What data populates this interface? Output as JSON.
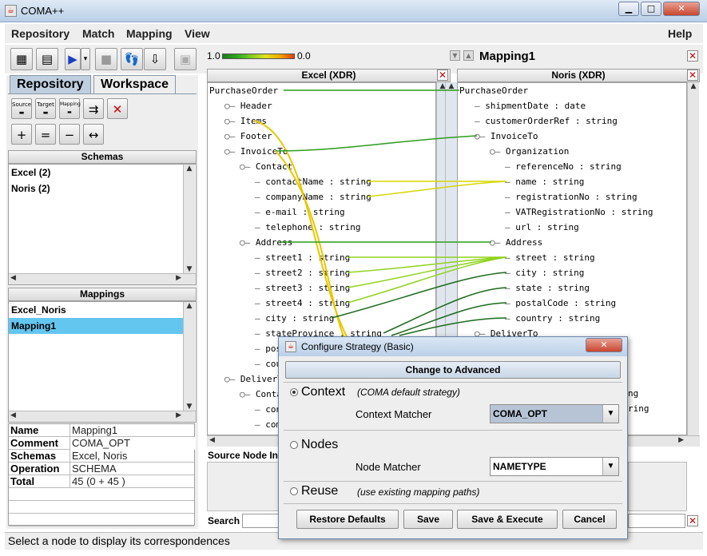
{
  "window": {
    "title": "COMA++"
  },
  "menu": {
    "items": [
      "Repository",
      "Match",
      "Mapping",
      "View"
    ],
    "help": "Help"
  },
  "legend": {
    "max": "1.0",
    "min": "0.0"
  },
  "tabs": {
    "repository": "Repository",
    "workspace": "Workspace"
  },
  "workspace_icons": {
    "source": "Source",
    "target": "Target",
    "mapping": "Mapping"
  },
  "schemas": {
    "header": "Schemas",
    "items": [
      "Excel (2)",
      "Noris (2)"
    ]
  },
  "mappings": {
    "header": "Mappings",
    "items": [
      "Excel_Noris",
      "Mapping1"
    ],
    "selected": "Mapping1"
  },
  "properties": [
    {
      "key": "Name",
      "value": "Mapping1"
    },
    {
      "key": "Comment",
      "value": "COMA_OPT"
    },
    {
      "key": "Schemas",
      "value": "Excel, Noris"
    },
    {
      "key": "Operation",
      "value": "SCHEMA"
    },
    {
      "key": "Total",
      "value": "45 (0 + 45 )"
    }
  ],
  "mapping_title": "Mapping1",
  "source_tree": {
    "header": "Excel (XDR)",
    "nodes": [
      {
        "label": "PurchaseOrder",
        "depth": 0
      },
      {
        "label": "Header",
        "depth": 1
      },
      {
        "label": "Items",
        "depth": 1
      },
      {
        "label": "Footer",
        "depth": 1
      },
      {
        "label": "InvoiceTo",
        "depth": 1
      },
      {
        "label": "Contact",
        "depth": 2
      },
      {
        "label": "contactName : string",
        "depth": 3
      },
      {
        "label": "companyName : string",
        "depth": 3
      },
      {
        "label": "e-mail : string",
        "depth": 3
      },
      {
        "label": "telephone : string",
        "depth": 3
      },
      {
        "label": "Address",
        "depth": 2
      },
      {
        "label": "street1 : string",
        "depth": 3
      },
      {
        "label": "street2 : string",
        "depth": 3
      },
      {
        "label": "street3 : string",
        "depth": 3
      },
      {
        "label": "street4 : string",
        "depth": 3
      },
      {
        "label": "city : string",
        "depth": 3
      },
      {
        "label": "stateProvince : string",
        "depth": 3
      },
      {
        "label": "postalCode : string",
        "depth": 3
      },
      {
        "label": "country : string",
        "depth": 3
      },
      {
        "label": "DeliverTo",
        "depth": 1
      },
      {
        "label": "Contact",
        "depth": 2
      },
      {
        "label": "contactName : string",
        "depth": 3
      },
      {
        "label": "companyName : string",
        "depth": 3
      }
    ]
  },
  "target_tree": {
    "header": "Noris (XDR)",
    "nodes": [
      {
        "label": "PurchaseOrder",
        "depth": 0
      },
      {
        "label": "shipmentDate : date",
        "depth": 1
      },
      {
        "label": "customerOrderRef : string",
        "depth": 1
      },
      {
        "label": "InvoiceTo",
        "depth": 1
      },
      {
        "label": "Organization",
        "depth": 2
      },
      {
        "label": "referenceNo : string",
        "depth": 3
      },
      {
        "label": "name : string",
        "depth": 3
      },
      {
        "label": "registrationNo : string",
        "depth": 3
      },
      {
        "label": "VATRegistrationNo : string",
        "depth": 3
      },
      {
        "label": "url : string",
        "depth": 3
      },
      {
        "label": "Address",
        "depth": 2
      },
      {
        "label": "street : string",
        "depth": 3
      },
      {
        "label": "city : string",
        "depth": 3
      },
      {
        "label": "state : string",
        "depth": 3
      },
      {
        "label": "postalCode : string",
        "depth": 3
      },
      {
        "label": "country : string",
        "depth": 3
      },
      {
        "label": "DeliverTo",
        "depth": 1
      }
    ],
    "clipped_right": [
      "ng",
      "ring"
    ]
  },
  "source_node_info": "Source Node Inf",
  "search_label": "Search",
  "status": "Select a node to display its correspondences",
  "dialog": {
    "title": "Configure Strategy (Basic)",
    "advanced_button": "Change to Advanced",
    "context": {
      "label": "Context",
      "note": "(COMA default strategy)",
      "matcher_label": "Context Matcher",
      "matcher_value": "COMA_OPT"
    },
    "nodes": {
      "label": "Nodes",
      "matcher_label": "Node Matcher",
      "matcher_value": "NAMETYPE"
    },
    "reuse": {
      "label": "Reuse",
      "note": "(use existing mapping paths)"
    },
    "buttons": {
      "restore": "Restore Defaults",
      "save": "Save",
      "save_execute": "Save & Execute",
      "cancel": "Cancel"
    }
  }
}
